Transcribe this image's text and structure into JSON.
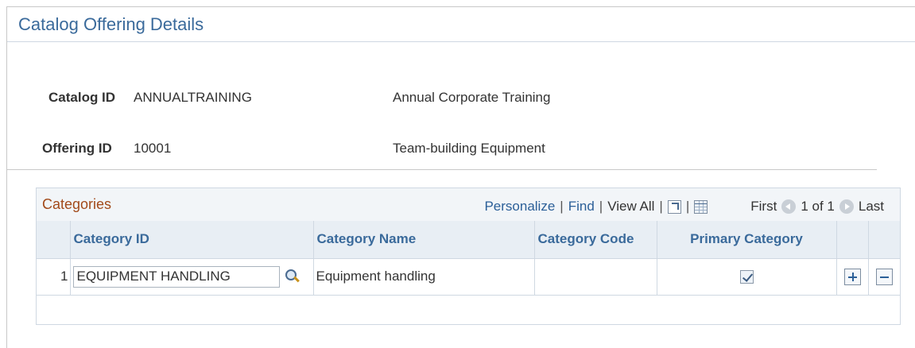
{
  "page": {
    "title": "Catalog Offering Details"
  },
  "fields": {
    "catalog_id_label": "Catalog ID",
    "catalog_id_value": "ANNUALTRAINING",
    "catalog_desc": "Annual Corporate Training",
    "offering_id_label": "Offering ID",
    "offering_id_value": "10001",
    "offering_desc": "Team-building Equipment"
  },
  "grid": {
    "title": "Categories",
    "nav": {
      "personalize": "Personalize",
      "find": "Find",
      "view_all": "View All",
      "first": "First",
      "range": "1 of 1",
      "last": "Last",
      "separator": "|"
    },
    "columns": [
      "Category ID",
      "Category Name",
      "Category Code",
      "Primary Category"
    ],
    "rows": [
      {
        "num": "1",
        "category_id": "EQUIPMENT HANDLING",
        "category_name": "Equipment handling",
        "category_code": "",
        "primary": true
      }
    ]
  },
  "icons": {
    "zoom": "zoom-grid-icon",
    "download": "download-spreadsheet-icon",
    "lookup": "lookup-magnifier-icon",
    "prev": "previous-icon",
    "next": "next-icon",
    "add": "add-row-icon",
    "delete": "delete-row-icon"
  },
  "colors": {
    "title_blue": "#3a6a9b",
    "grid_title": "#a24a1a",
    "link": "#2b5f98",
    "header_bg": "#e8eef4"
  }
}
